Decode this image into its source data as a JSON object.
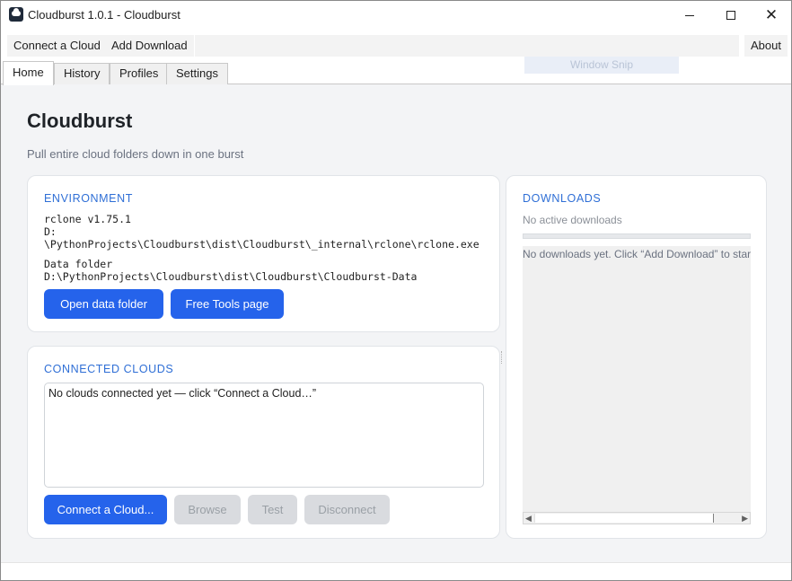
{
  "window": {
    "title": "Cloudburst 1.0.1 - Cloudburst",
    "minimize_icon": "minimize-icon",
    "maximize_icon": "maximize-icon",
    "close_icon": "close-icon"
  },
  "menu": {
    "connect_cloud": "Connect a Cloud",
    "add_download": "Add Download",
    "about": "About",
    "ghost_label": "Window Snip"
  },
  "tabs": [
    {
      "label": "Home",
      "active": true
    },
    {
      "label": "History",
      "active": false
    },
    {
      "label": "Profiles",
      "active": false
    },
    {
      "label": "Settings",
      "active": false
    }
  ],
  "home": {
    "title": "Cloudburst",
    "subtitle": "Pull entire cloud folders down in one burst"
  },
  "environment": {
    "heading": "ENVIRONMENT",
    "rclone_version": "rclone v1.75.1",
    "rclone_path_drive": "D:",
    "rclone_path": "\\PythonProjects\\Cloudburst\\dist\\Cloudburst\\_internal\\rclone\\rclone.exe",
    "data_folder_label": "Data folder",
    "data_folder_path": "D:\\PythonProjects\\Cloudburst\\dist\\Cloudburst\\Cloudburst-Data",
    "open_data_folder": "Open data folder",
    "free_tools_page": "Free Tools page"
  },
  "connected_clouds": {
    "heading": "CONNECTED CLOUDS",
    "empty_message": "No clouds connected yet — click “Connect a Cloud…”",
    "connect_button": "Connect a Cloud...",
    "browse_button": "Browse",
    "test_button": "Test",
    "disconnect_button": "Disconnect"
  },
  "downloads": {
    "heading": "DOWNLOADS",
    "status": "No active downloads",
    "log_message": "No downloads yet. Click “Add Download” to start."
  },
  "colors": {
    "accent": "#2563eb",
    "heading_blue": "#2f6fd6",
    "disabled_bg": "#d9dbdf",
    "content_bg": "#f3f4f6"
  }
}
